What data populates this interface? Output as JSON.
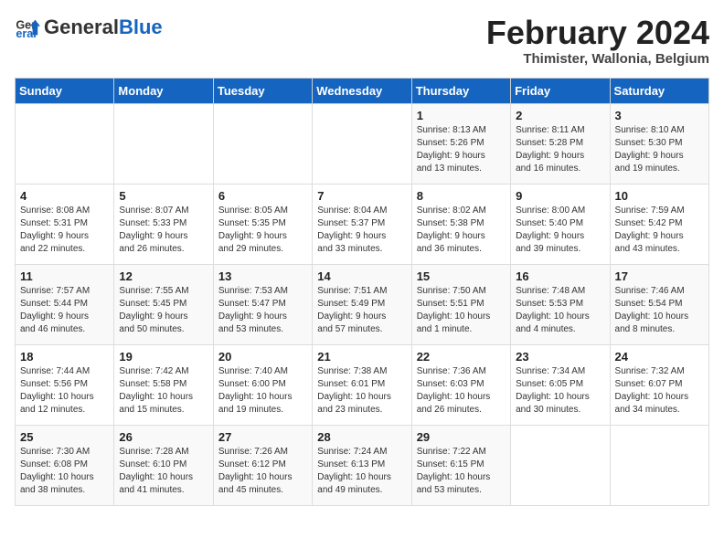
{
  "logo": {
    "general": "General",
    "blue": "Blue"
  },
  "title": "February 2024",
  "subtitle": "Thimister, Wallonia, Belgium",
  "days_header": [
    "Sunday",
    "Monday",
    "Tuesday",
    "Wednesday",
    "Thursday",
    "Friday",
    "Saturday"
  ],
  "weeks": [
    [
      {
        "day": "",
        "info": ""
      },
      {
        "day": "",
        "info": ""
      },
      {
        "day": "",
        "info": ""
      },
      {
        "day": "",
        "info": ""
      },
      {
        "day": "1",
        "info": "Sunrise: 8:13 AM\nSunset: 5:26 PM\nDaylight: 9 hours\nand 13 minutes."
      },
      {
        "day": "2",
        "info": "Sunrise: 8:11 AM\nSunset: 5:28 PM\nDaylight: 9 hours\nand 16 minutes."
      },
      {
        "day": "3",
        "info": "Sunrise: 8:10 AM\nSunset: 5:30 PM\nDaylight: 9 hours\nand 19 minutes."
      }
    ],
    [
      {
        "day": "4",
        "info": "Sunrise: 8:08 AM\nSunset: 5:31 PM\nDaylight: 9 hours\nand 22 minutes."
      },
      {
        "day": "5",
        "info": "Sunrise: 8:07 AM\nSunset: 5:33 PM\nDaylight: 9 hours\nand 26 minutes."
      },
      {
        "day": "6",
        "info": "Sunrise: 8:05 AM\nSunset: 5:35 PM\nDaylight: 9 hours\nand 29 minutes."
      },
      {
        "day": "7",
        "info": "Sunrise: 8:04 AM\nSunset: 5:37 PM\nDaylight: 9 hours\nand 33 minutes."
      },
      {
        "day": "8",
        "info": "Sunrise: 8:02 AM\nSunset: 5:38 PM\nDaylight: 9 hours\nand 36 minutes."
      },
      {
        "day": "9",
        "info": "Sunrise: 8:00 AM\nSunset: 5:40 PM\nDaylight: 9 hours\nand 39 minutes."
      },
      {
        "day": "10",
        "info": "Sunrise: 7:59 AM\nSunset: 5:42 PM\nDaylight: 9 hours\nand 43 minutes."
      }
    ],
    [
      {
        "day": "11",
        "info": "Sunrise: 7:57 AM\nSunset: 5:44 PM\nDaylight: 9 hours\nand 46 minutes."
      },
      {
        "day": "12",
        "info": "Sunrise: 7:55 AM\nSunset: 5:45 PM\nDaylight: 9 hours\nand 50 minutes."
      },
      {
        "day": "13",
        "info": "Sunrise: 7:53 AM\nSunset: 5:47 PM\nDaylight: 9 hours\nand 53 minutes."
      },
      {
        "day": "14",
        "info": "Sunrise: 7:51 AM\nSunset: 5:49 PM\nDaylight: 9 hours\nand 57 minutes."
      },
      {
        "day": "15",
        "info": "Sunrise: 7:50 AM\nSunset: 5:51 PM\nDaylight: 10 hours\nand 1 minute."
      },
      {
        "day": "16",
        "info": "Sunrise: 7:48 AM\nSunset: 5:53 PM\nDaylight: 10 hours\nand 4 minutes."
      },
      {
        "day": "17",
        "info": "Sunrise: 7:46 AM\nSunset: 5:54 PM\nDaylight: 10 hours\nand 8 minutes."
      }
    ],
    [
      {
        "day": "18",
        "info": "Sunrise: 7:44 AM\nSunset: 5:56 PM\nDaylight: 10 hours\nand 12 minutes."
      },
      {
        "day": "19",
        "info": "Sunrise: 7:42 AM\nSunset: 5:58 PM\nDaylight: 10 hours\nand 15 minutes."
      },
      {
        "day": "20",
        "info": "Sunrise: 7:40 AM\nSunset: 6:00 PM\nDaylight: 10 hours\nand 19 minutes."
      },
      {
        "day": "21",
        "info": "Sunrise: 7:38 AM\nSunset: 6:01 PM\nDaylight: 10 hours\nand 23 minutes."
      },
      {
        "day": "22",
        "info": "Sunrise: 7:36 AM\nSunset: 6:03 PM\nDaylight: 10 hours\nand 26 minutes."
      },
      {
        "day": "23",
        "info": "Sunrise: 7:34 AM\nSunset: 6:05 PM\nDaylight: 10 hours\nand 30 minutes."
      },
      {
        "day": "24",
        "info": "Sunrise: 7:32 AM\nSunset: 6:07 PM\nDaylight: 10 hours\nand 34 minutes."
      }
    ],
    [
      {
        "day": "25",
        "info": "Sunrise: 7:30 AM\nSunset: 6:08 PM\nDaylight: 10 hours\nand 38 minutes."
      },
      {
        "day": "26",
        "info": "Sunrise: 7:28 AM\nSunset: 6:10 PM\nDaylight: 10 hours\nand 41 minutes."
      },
      {
        "day": "27",
        "info": "Sunrise: 7:26 AM\nSunset: 6:12 PM\nDaylight: 10 hours\nand 45 minutes."
      },
      {
        "day": "28",
        "info": "Sunrise: 7:24 AM\nSunset: 6:13 PM\nDaylight: 10 hours\nand 49 minutes."
      },
      {
        "day": "29",
        "info": "Sunrise: 7:22 AM\nSunset: 6:15 PM\nDaylight: 10 hours\nand 53 minutes."
      },
      {
        "day": "",
        "info": ""
      },
      {
        "day": "",
        "info": ""
      }
    ]
  ]
}
